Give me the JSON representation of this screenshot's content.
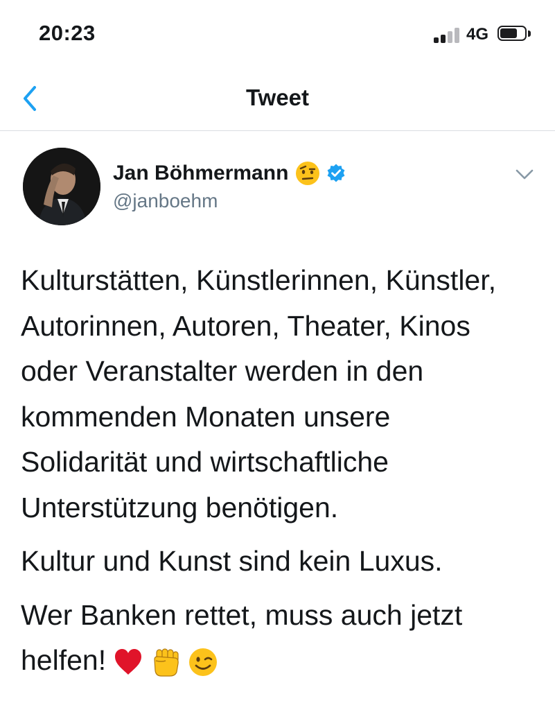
{
  "status_bar": {
    "time": "20:23",
    "network": "4G",
    "icons": [
      "signal-icon",
      "battery-icon"
    ]
  },
  "nav": {
    "back_icon": "chevron-left-icon",
    "title": "Tweet"
  },
  "author": {
    "display_name": "Jan Böhmermann",
    "name_emoji": "raised-eyebrow-emoji-icon",
    "verified_icon": "verified-badge-icon",
    "handle": "@janboehm",
    "more_icon": "chevron-down-icon"
  },
  "tweet": {
    "paragraphs": [
      "Kulturstätten, Künstlerinnen, Künstler,\nAutorinnen, Autoren, Theater, Kinos\noder Veranstalter werden in den\nkommenden Monaten unsere\nSolidarität und wirtschaftliche\nUnterstützung benötigen.",
      "Kultur und Kunst sind kein Luxus.",
      "Wer Banken rettet, muss auch jetzt\nhelfen!"
    ],
    "trailing_emojis": [
      "red-heart-emoji-icon",
      "raised-fist-emoji-icon",
      "winking-face-emoji-icon"
    ]
  },
  "colors": {
    "accent": "#1da1f2",
    "text": "#14171a",
    "secondary": "#657786",
    "divider": "#d9dde1"
  }
}
